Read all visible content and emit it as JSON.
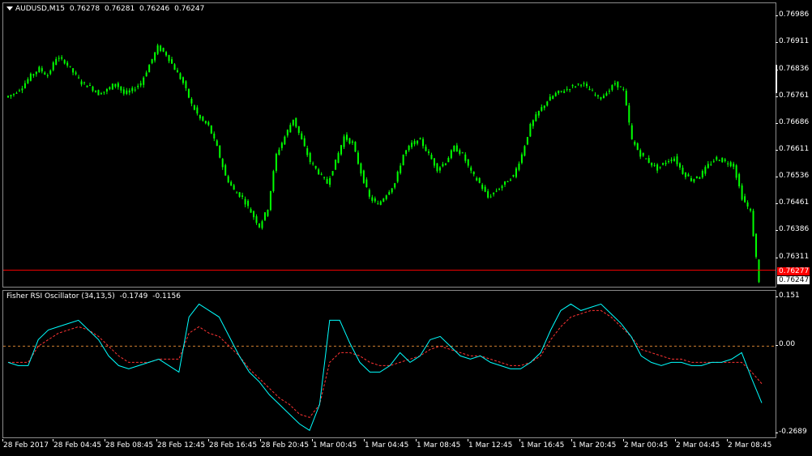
{
  "chart": {
    "symbol_label": "AUDUSD,M15",
    "ohlc": [
      "0.76278",
      "0.76281",
      "0.76246",
      "0.76247"
    ],
    "bid_price": "0.76247",
    "ask_price": "0.76277",
    "colors": {
      "candle": "#00ff00",
      "bid_line": "#ff0000",
      "ask_line": "#ff0000",
      "background": "#000000",
      "axis_text": "#ffffff"
    }
  },
  "price_axis": [
    "0.76986",
    "0.76911",
    "0.76836",
    "0.76761",
    "0.76686",
    "0.76611",
    "0.76536",
    "0.76461",
    "0.76386",
    "0.76311"
  ],
  "indicator": {
    "name": "Fisher RSI Oscillator (34,13,5)",
    "values": [
      "-0.1749",
      "-0.1156"
    ],
    "axis": [
      "0.151",
      "0.00",
      "-0.2689"
    ],
    "colors": {
      "fisher": "#00ffff",
      "signal": "#ff3333",
      "zero_line": "#d08030"
    }
  },
  "time_axis": [
    "28 Feb 2017",
    "28 Feb 04:45",
    "28 Feb 08:45",
    "28 Feb 12:45",
    "28 Feb 16:45",
    "28 Feb 20:45",
    "1 Mar 00:45",
    "1 Mar 04:45",
    "1 Mar 08:45",
    "1 Mar 12:45",
    "1 Mar 16:45",
    "1 Mar 20:45",
    "2 Mar 00:45",
    "2 Mar 04:45",
    "2 Mar 08:45"
  ],
  "chart_data": [
    {
      "type": "candlestick",
      "title": "AUDUSD,M15",
      "ylim": [
        0.7624,
        0.77
      ],
      "x_ticks": [
        "28 Feb 2017",
        "28 Feb 04:45",
        "28 Feb 08:45",
        "28 Feb 12:45",
        "28 Feb 16:45",
        "28 Feb 20:45",
        "1 Mar 00:45",
        "1 Mar 04:45",
        "1 Mar 08:45",
        "1 Mar 12:45",
        "1 Mar 16:45",
        "1 Mar 20:45",
        "2 Mar 00:45",
        "2 Mar 04:45",
        "2 Mar 08:45"
      ],
      "close_series": [
        0.7676,
        0.7677,
        0.7679,
        0.7682,
        0.7684,
        0.7682,
        0.7687,
        0.7686,
        0.7683,
        0.768,
        0.7679,
        0.7677,
        0.7678,
        0.768,
        0.7677,
        0.7678,
        0.768,
        0.7685,
        0.769,
        0.7688,
        0.7684,
        0.768,
        0.7674,
        0.767,
        0.7668,
        0.7662,
        0.7654,
        0.765,
        0.7648,
        0.7644,
        0.764,
        0.7645,
        0.766,
        0.7665,
        0.767,
        0.7664,
        0.7658,
        0.7655,
        0.7652,
        0.7658,
        0.7665,
        0.7663,
        0.7655,
        0.7648,
        0.7646,
        0.7649,
        0.7652,
        0.766,
        0.7663,
        0.7664,
        0.766,
        0.7656,
        0.7658,
        0.7662,
        0.766,
        0.7655,
        0.7652,
        0.7648,
        0.765,
        0.7652,
        0.7654,
        0.766,
        0.7668,
        0.7672,
        0.7675,
        0.7677,
        0.7678,
        0.7679,
        0.768,
        0.7678,
        0.7676,
        0.7677,
        0.768,
        0.7678,
        0.7664,
        0.766,
        0.7658,
        0.7656,
        0.7658,
        0.7659,
        0.7655,
        0.7653,
        0.7654,
        0.7657,
        0.7659,
        0.7658,
        0.7657,
        0.7648,
        0.7644,
        0.76247
      ],
      "indicator_lines": [
        {
          "name": "Fisher RSI",
          "values": [
            -0.05,
            -0.06,
            -0.06,
            0.02,
            0.05,
            0.06,
            0.07,
            0.08,
            0.05,
            0.02,
            -0.03,
            -0.06,
            -0.07,
            -0.06,
            -0.05,
            -0.04,
            -0.06,
            -0.08,
            0.09,
            0.13,
            0.11,
            0.09,
            0.03,
            -0.03,
            -0.08,
            -0.11,
            -0.15,
            -0.18,
            -0.21,
            -0.24,
            -0.26,
            -0.18,
            0.08,
            0.08,
            0.01,
            -0.05,
            -0.08,
            -0.08,
            -0.06,
            -0.02,
            -0.05,
            -0.03,
            0.02,
            0.03,
            0.0,
            -0.03,
            -0.04,
            -0.03,
            -0.05,
            -0.06,
            -0.07,
            -0.07,
            -0.05,
            -0.02,
            0.05,
            0.11,
            0.13,
            0.11,
            0.12,
            0.13,
            0.1,
            0.07,
            0.03,
            -0.03,
            -0.05,
            -0.06,
            -0.05,
            -0.05,
            -0.06,
            -0.06,
            -0.05,
            -0.05,
            -0.04,
            -0.02,
            -0.1,
            -0.1749
          ]
        },
        {
          "name": "Signal",
          "values": [
            -0.05,
            -0.05,
            -0.05,
            0.0,
            0.02,
            0.04,
            0.05,
            0.06,
            0.05,
            0.03,
            0.0,
            -0.03,
            -0.05,
            -0.05,
            -0.05,
            -0.04,
            -0.04,
            -0.04,
            0.04,
            0.06,
            0.04,
            0.03,
            0.0,
            -0.03,
            -0.07,
            -0.1,
            -0.13,
            -0.16,
            -0.18,
            -0.21,
            -0.22,
            -0.18,
            -0.05,
            -0.02,
            -0.02,
            -0.03,
            -0.05,
            -0.06,
            -0.06,
            -0.05,
            -0.04,
            -0.03,
            -0.01,
            0.0,
            -0.01,
            -0.02,
            -0.03,
            -0.03,
            -0.04,
            -0.05,
            -0.06,
            -0.06,
            -0.05,
            -0.03,
            0.02,
            0.06,
            0.09,
            0.1,
            0.11,
            0.11,
            0.09,
            0.06,
            0.03,
            -0.01,
            -0.02,
            -0.03,
            -0.04,
            -0.04,
            -0.05,
            -0.05,
            -0.05,
            -0.05,
            -0.05,
            -0.05,
            -0.08,
            -0.1156
          ]
        }
      ],
      "indicator_ylim": [
        -0.2689,
        0.151
      ]
    }
  ]
}
